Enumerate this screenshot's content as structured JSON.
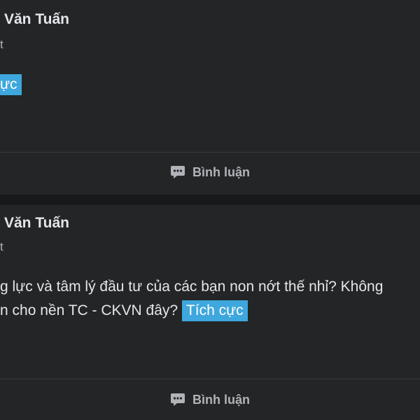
{
  "posts": [
    {
      "author": "Văn Tuấn",
      "meta": "t",
      "lines": [],
      "tag": "ực",
      "action_label": "Bình luận",
      "action_icon": "comment-icon"
    },
    {
      "author": "Văn Tuấn",
      "meta": "t",
      "lines": [
        "g lực và tâm lý đầu tư của các bạn non nớt thế nhỉ? Không",
        "n cho nền TC - CKVN đây?"
      ],
      "tag": "Tích cực",
      "action_label": "Bình luận",
      "action_icon": "comment-icon"
    }
  ],
  "colors": {
    "background": "#18191a",
    "card": "#242526",
    "tag": "#3ea7dd",
    "text": "#e4e6eb",
    "muted": "#b0b3b8"
  }
}
